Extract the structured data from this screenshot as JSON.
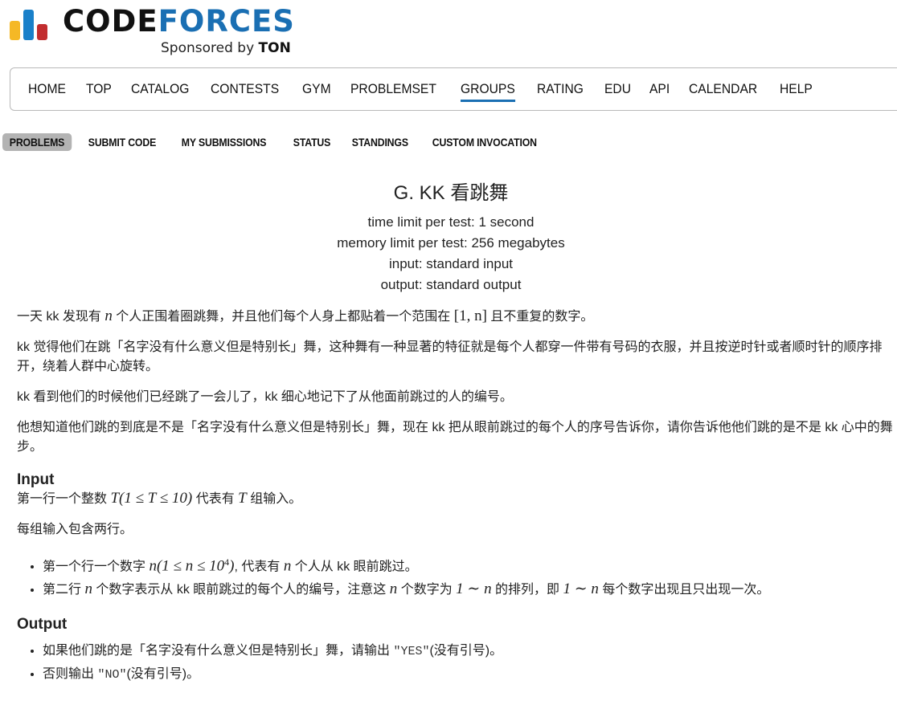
{
  "logo": {
    "text_code": "CODE",
    "text_forces": "FORCES",
    "sponsor_prefix": "Sponsored by",
    "sponsor_name": "TON",
    "colors": {
      "yellow": "#f5b825",
      "blue": "#1a80c9",
      "red": "#c22d2f"
    }
  },
  "main_menu": {
    "items": [
      "HOME",
      "TOP",
      "CATALOG",
      "CONTESTS",
      "GYM",
      "PROBLEMSET",
      "GROUPS",
      "RATING",
      "EDU",
      "API",
      "CALENDAR",
      "HELP"
    ],
    "active": "GROUPS"
  },
  "second_menu": {
    "items": [
      "PROBLEMS",
      "SUBMIT CODE",
      "MY SUBMISSIONS",
      "STATUS",
      "STANDINGS",
      "CUSTOM INVOCATION"
    ],
    "active": "PROBLEMS"
  },
  "problem": {
    "title": "G. KK 看跳舞",
    "time_limit": "time limit per test: 1 second",
    "memory_limit": "memory limit per test: 256 megabytes",
    "input_file": "input: standard input",
    "output_file": "output: standard output",
    "legend": {
      "p1_a": "一天 kk 发现有 ",
      "p1_n": "n",
      "p1_b": " 个人正围着圈跳舞，并且他们每个人身上都贴着一个范围在 ",
      "p1_range": "[1, n]",
      "p1_c": " 且不重复的数字。",
      "p2": "kk 觉得他们在跳「名字没有什么意义但是特别长」舞，这种舞有一种显著的特征就是每个人都穿一件带有号码的衣服，并且按逆时针或者顺时针的顺序排开，绕着人群中心旋转。",
      "p3": "kk 看到他们的时候他们已经跳了一会儿了，kk 细心地记下了从他面前跳过的人的编号。",
      "p4": "他想知道他们跳的到底是不是「名字没有什么意义但是特别长」舞，现在 kk 把从眼前跳过的每个人的序号告诉你，请你告诉他他们跳的是不是 kk 心中的舞步。"
    },
    "input": {
      "header": "Input",
      "l1_a": "第一行一个整数 ",
      "l1_math": "T(1 ≤ T ≤ 10)",
      "l1_b": " 代表有 ",
      "l1_T": "T",
      "l1_c": " 组输入。",
      "l2": "每组输入包含两行。",
      "b1_a": "第一个行一个数字 ",
      "b1_math": "n(1 ≤ n ≤ 10",
      "b1_sup": "4",
      "b1_close": ")",
      "b1_b": ", 代表有 ",
      "b1_n": "n",
      "b1_c": " 个人从 kk 眼前跳过。",
      "b2_a": "第二行 ",
      "b2_n": "n",
      "b2_b": " 个数字表示从 kk 眼前跳过的每个人的编号，注意这 ",
      "b2_n2": "n",
      "b2_c": " 个数字为 ",
      "b2_r1": "1 ∼ n",
      "b2_d": " 的排列，即 ",
      "b2_r2": "1 ∼ n",
      "b2_e": " 每个数字出现且只出现一次。"
    },
    "output": {
      "header": "Output",
      "b1_a": "如果他们跳的是「名字没有什么意义但是特别长」舞，请输出 ",
      "b1_code": "\"YES\"",
      "b1_b": "(没有引号)。",
      "b2_a": "否则输出 ",
      "b2_code": "\"NO\"",
      "b2_b": "(没有引号)。"
    }
  }
}
